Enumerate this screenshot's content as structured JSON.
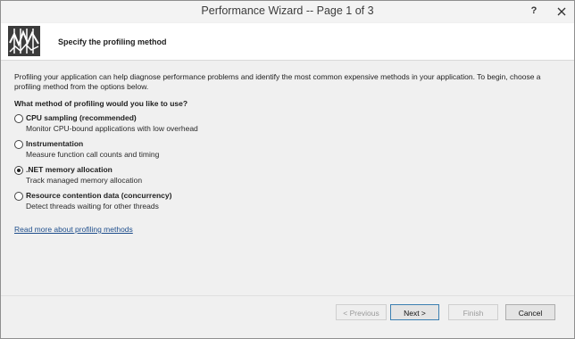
{
  "window": {
    "title": "Performance Wizard -- Page 1 of 3",
    "help": "?"
  },
  "header": {
    "title": "Specify the profiling method"
  },
  "body": {
    "description": "Profiling your application can help diagnose performance problems and identify the most common expensive methods in your application. To begin, choose a profiling method from the options below.",
    "question": "What method of profiling would you like to use?",
    "options": [
      {
        "label": "CPU sampling (recommended)",
        "desc": "Monitor CPU-bound applications with low overhead",
        "selected": false
      },
      {
        "label": "Instrumentation",
        "desc": "Measure function call counts and timing",
        "selected": false
      },
      {
        "label": ".NET memory allocation",
        "desc": "Track managed memory allocation",
        "selected": true
      },
      {
        "label": "Resource contention data (concurrency)",
        "desc": "Detect threads waiting for other threads",
        "selected": false
      }
    ],
    "link": "Read more about profiling methods"
  },
  "buttons": {
    "previous": "< Previous",
    "next": "Next >",
    "finish": "Finish",
    "cancel": "Cancel"
  }
}
